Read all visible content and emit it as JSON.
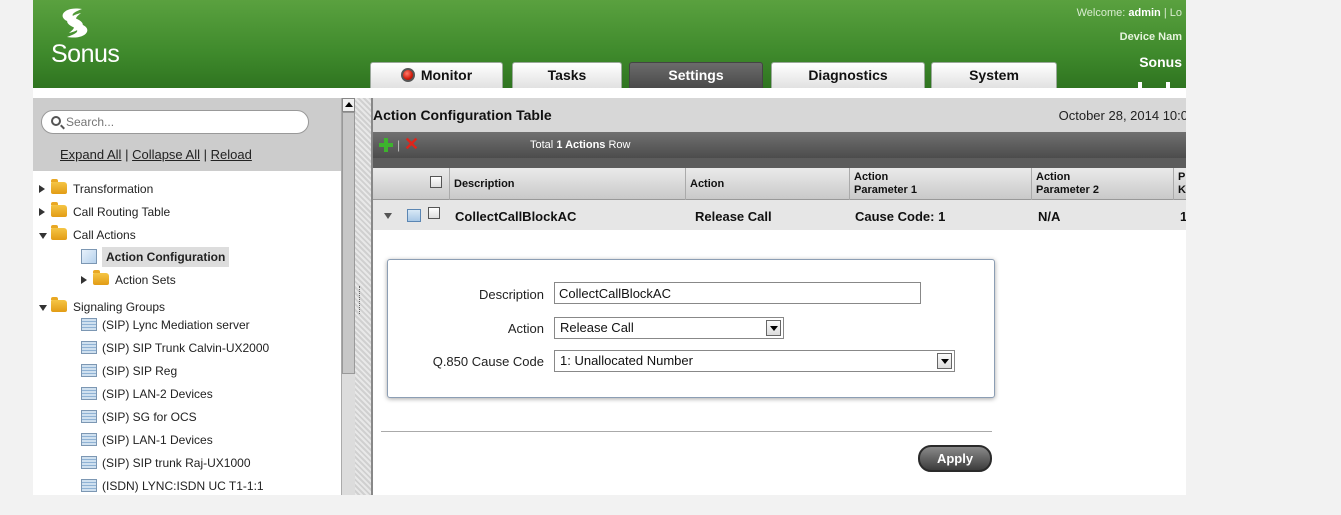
{
  "header": {
    "logo_text": "Sonus",
    "welcome_prefix": "Welcome:",
    "user": "admin",
    "logout": "| Lo",
    "device_label": "Device Nam",
    "device_value": "Sonus"
  },
  "tabs": [
    {
      "label": "Monitor",
      "active": false
    },
    {
      "label": "Tasks",
      "active": false
    },
    {
      "label": "Settings",
      "active": true
    },
    {
      "label": "Diagnostics",
      "active": false
    },
    {
      "label": "System",
      "active": false
    }
  ],
  "sidebar": {
    "search_placeholder": "Search...",
    "expand_all": "Expand All",
    "collapse_all": "Collapse All",
    "reload": "Reload",
    "link_sep": "|",
    "tree": {
      "transformation": "Transformation",
      "call_routing_table": "Call Routing Table",
      "call_actions": "Call Actions",
      "action_configuration": "Action Configuration",
      "action_sets": "Action Sets",
      "signaling_groups": "Signaling Groups",
      "sg_items": [
        "(SIP) Lync Mediation server",
        "(SIP) SIP Trunk Calvin-UX2000",
        "(SIP) SIP Reg",
        "(SIP) LAN-2 Devices",
        "(SIP) SG for OCS",
        "(SIP) LAN-1 Devices",
        "(SIP) SIP trunk Raj-UX1000",
        "(ISDN) LYNC:ISDN UC T1-1:1"
      ]
    }
  },
  "main": {
    "title": "Action Configuration Table",
    "date": "October 28, 2014 10:0",
    "toolbar": {
      "separator": "|",
      "delete_glyph": "✕",
      "total_prefix": "Total",
      "total_count": "1 Actions",
      "total_suffix": "Row"
    },
    "grid": {
      "headers": {
        "description": "Description",
        "action": "Action",
        "param1_line1": "Action",
        "param1_line2": "Parameter 1",
        "param2_line1": "Action",
        "param2_line2": "Parameter 2",
        "extra_line1": "P",
        "extra_line2": "K"
      },
      "row": {
        "description": "CollectCallBlockAC",
        "action": "Release Call",
        "param1": "Cause Code: 1",
        "param2": "N/A",
        "extra": "1"
      }
    },
    "form": {
      "description_label": "Description",
      "description_value": "CollectCallBlockAC",
      "action_label": "Action",
      "action_value": "Release Call",
      "cause_label": "Q.850 Cause Code",
      "cause_value": "1: Unallocated Number",
      "apply_label": "Apply"
    }
  }
}
